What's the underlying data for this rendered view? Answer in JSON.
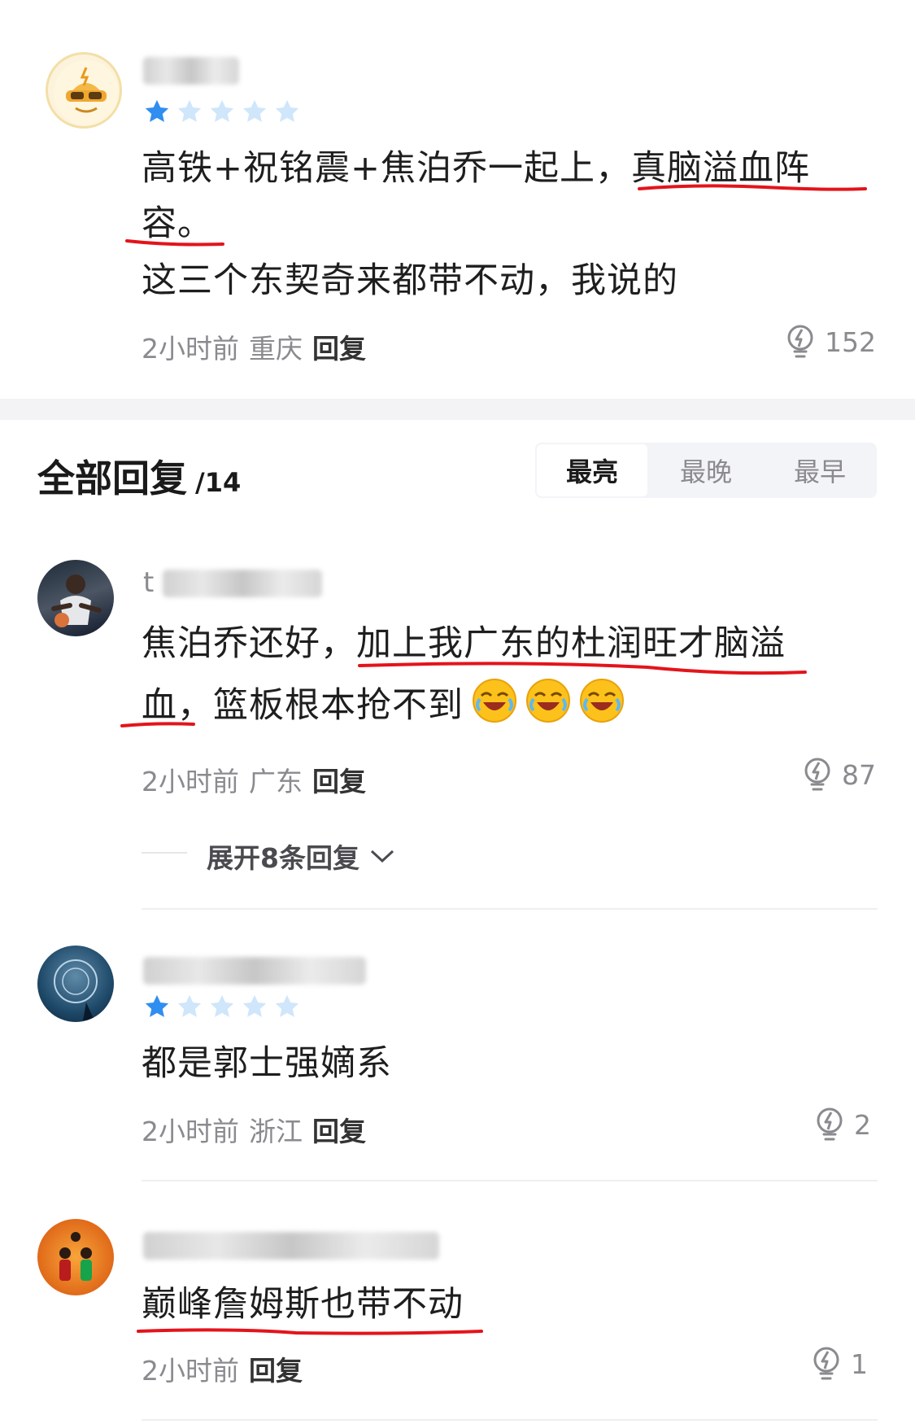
{
  "top_comment": {
    "rating": 1,
    "line1": "高铁+祝铭震+焦泊乔一起上，真脑溢血阵",
    "line2": "容。",
    "line3": "这三个东契奇来都带不动，我说的",
    "time": "2小时前",
    "location": "重庆",
    "reply_label": "回复",
    "likes": "152"
  },
  "replies_header": {
    "title": "全部回复",
    "count": "/14",
    "sort_tabs": [
      "最亮",
      "最晚",
      "最早"
    ],
    "active_tab": "最亮"
  },
  "replies": [
    {
      "name_visible": "t",
      "line1": "焦泊乔还好，加上我广东的杜润旺才脑溢",
      "line2": "血，篮板根本抢不到",
      "emoji_count": 3,
      "time": "2小时前",
      "location": "广东",
      "reply_label": "回复",
      "likes": "87",
      "expand_label": "展开8条回复"
    },
    {
      "rating": 1,
      "line1": "都是郭士强嫡系",
      "time": "2小时前",
      "location": "浙江",
      "reply_label": "回复",
      "likes": "2"
    },
    {
      "line1": "巅峰詹姆斯也带不动",
      "time": "2小时前",
      "reply_label": "回复",
      "likes": "1"
    }
  ],
  "colors": {
    "star_active": "#2f8ef0",
    "star_inactive": "#cfe6fb",
    "underline": "#e3141b",
    "meta": "#8a8a8f"
  }
}
